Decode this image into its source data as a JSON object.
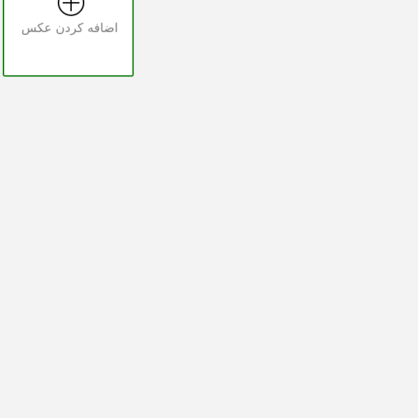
{
  "add_photo": {
    "label": "اضافه کردن عکس",
    "icon": "plus-circle-icon",
    "border_color": "#0a7a0a"
  }
}
